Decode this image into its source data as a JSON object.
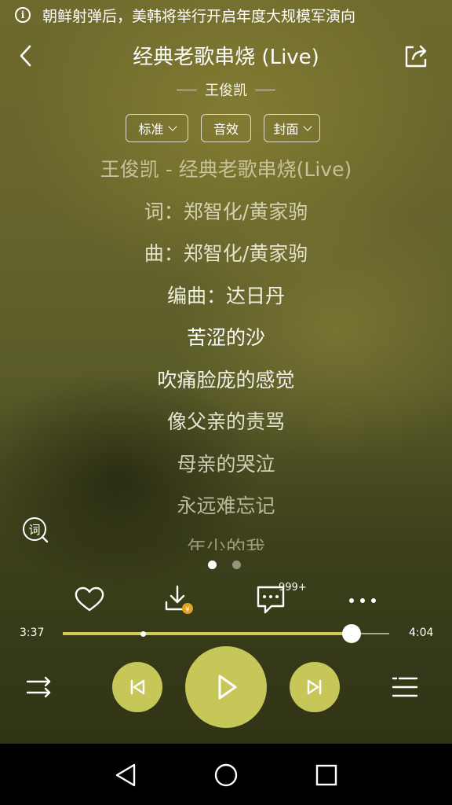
{
  "notification": {
    "text": "朝鲜射弹后，美韩将举行开启年度大规模军演向",
    "icon": "info-icon"
  },
  "header": {
    "title": "经典老歌串烧 (Live)",
    "artist": "王俊凯"
  },
  "options": [
    {
      "label": "标准",
      "dropdown": true
    },
    {
      "label": "音效",
      "dropdown": false
    },
    {
      "label": "封面",
      "dropdown": true
    }
  ],
  "lyrics": [
    "王俊凯 - 经典老歌串烧(Live)",
    "词：郑智化/黄家驹",
    "曲：郑智化/黄家驹",
    "编曲：达日丹",
    "苦涩的沙",
    "吹痛脸庞的感觉",
    "像父亲的责骂",
    "母亲的哭泣",
    "永远难忘记",
    "年少的我"
  ],
  "lyric_toggle": {
    "label": "词"
  },
  "pager": {
    "active": 0,
    "count": 2
  },
  "actions": {
    "comment_count": "999+"
  },
  "progress": {
    "elapsed": "3:37",
    "total": "4:04",
    "fraction": 0.885
  },
  "colors": {
    "accent": "#c7c659",
    "background": "#5f5e2a"
  },
  "icons": [
    "back-icon",
    "share-icon",
    "heart-icon",
    "download-icon",
    "comment-icon",
    "more-icon",
    "shuffle-icon",
    "previous-icon",
    "play-icon",
    "next-icon",
    "playlist-icon"
  ]
}
